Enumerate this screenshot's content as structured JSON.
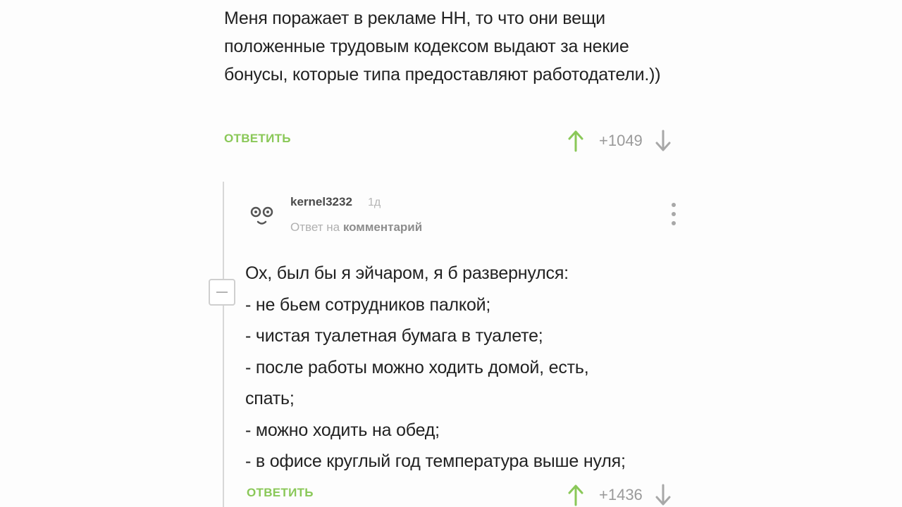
{
  "first_comment": {
    "text": "Меня поражает в рекламе НН, то что они вещи положенные трудовым кодексом выдают за некие бонусы, которые типа предоставляют работодатели.))",
    "reply_label": "ОТВЕТИТЬ",
    "rating": "+1049"
  },
  "reply_comment": {
    "username": "kernel3232",
    "time": "1д",
    "reply_prefix": "Ответ на",
    "reply_target": "комментарий",
    "lines": [
      "Ох, был бы я эйчаром, я б развернулся:",
      "- не бьем сотрудников палкой;",
      "- чистая туалетная бумага в туалете;",
      "- после работы можно ходить домой, есть,",
      "спать;",
      "- можно ходить на обед;",
      "- в офисе круглый год температура выше нуля;"
    ],
    "reply_label": "ОТВЕТИТЬ",
    "rating": "+1436"
  },
  "icons": {
    "upvote": "arrow-up-icon",
    "downvote": "arrow-down-icon",
    "more": "more-vertical-icon",
    "collapse": "minus-icon",
    "avatar": "face-avatar-icon"
  },
  "colors": {
    "accent_green": "#8ac858",
    "upvote_green": "#8ac858",
    "muted_gray": "#9a9a9a",
    "text": "#222222"
  }
}
